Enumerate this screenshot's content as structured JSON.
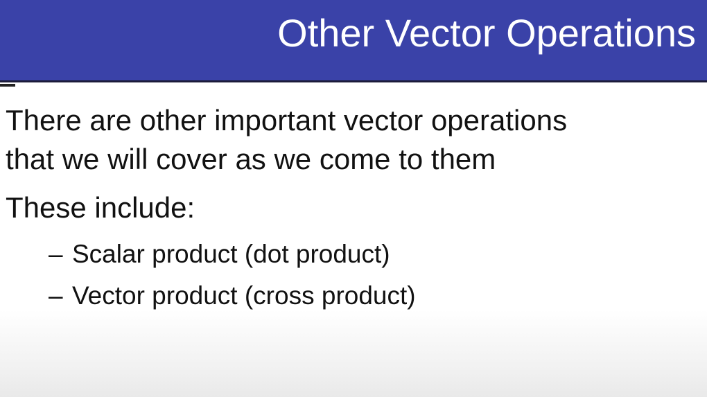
{
  "slide": {
    "title": "Other Vector Operations",
    "bullets": [
      {
        "lines": [
          "There are other important vector operations",
          "that we will cover as we come to them"
        ]
      },
      {
        "lines": [
          "These include:"
        ]
      }
    ],
    "sub_items": [
      {
        "marker": "–",
        "text": "Scalar product (dot product)"
      },
      {
        "marker": "–",
        "text": "Vector product (cross product)"
      }
    ],
    "colors": {
      "title_bar": "#3a42a8",
      "title_text": "#ffffff",
      "body_text": "#111111"
    }
  }
}
